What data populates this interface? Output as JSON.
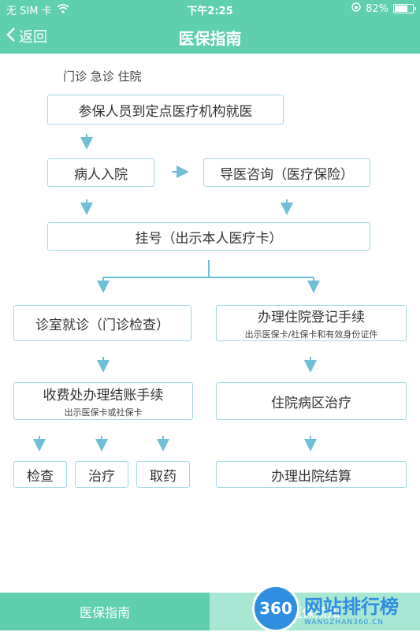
{
  "status_bar": {
    "carrier": "无 SIM 卡",
    "time": "下午2:25",
    "battery": "82%",
    "battery_level": 0.82
  },
  "nav": {
    "back_label": "返回",
    "title": "医保指南"
  },
  "flow": {
    "header": "门诊 急诊 住院",
    "step_insured": "参保人员到定点医疗机构就医",
    "step_admit": "病人入院",
    "step_consult": "导医咨询（医疗保险）",
    "step_register": "挂号（出示本人医疗卡）",
    "step_clinic": "诊室就诊（门诊检查）",
    "step_inpatient_reg": "办理住院登记手续",
    "step_inpatient_reg_note": "出示医保卡/社保卡和有效身份证件",
    "step_billing": "收费处办理结账手续",
    "step_billing_note": "出示医保卡或社保卡",
    "step_ward": "住院病区治疗",
    "step_exam": "检查",
    "step_treat": "治疗",
    "step_medicine": "取药",
    "step_discharge": "办理出院结算"
  },
  "tabs": {
    "tab1": "医保指南",
    "tab2": "医保须知"
  },
  "watermark": {
    "logo": "360",
    "name": "网站排行榜",
    "url": "WANGZHAN360.CN"
  },
  "colors": {
    "accent": "#5fcfae",
    "box_border": "#9fd6e6",
    "arrow": "#6fbfd6"
  }
}
